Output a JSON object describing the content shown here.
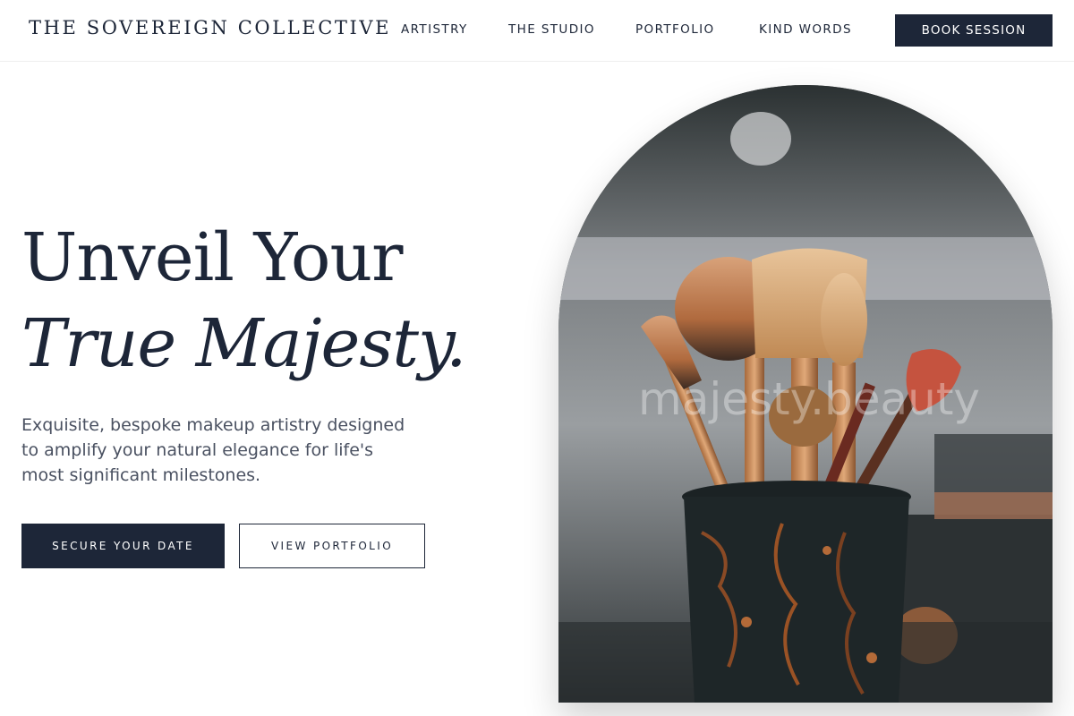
{
  "header": {
    "brand": "THE SOVEREIGN COLLECTIVE",
    "nav": [
      {
        "label": "ARTISTRY"
      },
      {
        "label": "THE STUDIO"
      },
      {
        "label": "PORTFOLIO"
      },
      {
        "label": "KIND WORDS"
      }
    ],
    "cta_label": "BOOK SESSION"
  },
  "hero": {
    "title_line1": "Unveil Your",
    "title_line2": "True Majesty.",
    "subtitle": "Exquisite, bespoke makeup artistry designed to amplify your natural elegance for life's most significant milestones.",
    "primary_cta": "SECURE YOUR DATE",
    "secondary_cta": "VIEW PORTFOLIO"
  },
  "image": {
    "watermark": "majesty.beauty",
    "subject": "makeup-brushes-in-holder"
  },
  "colors": {
    "accent": "#1d2638",
    "text_muted": "#4a5161",
    "background": "#ffffff"
  }
}
